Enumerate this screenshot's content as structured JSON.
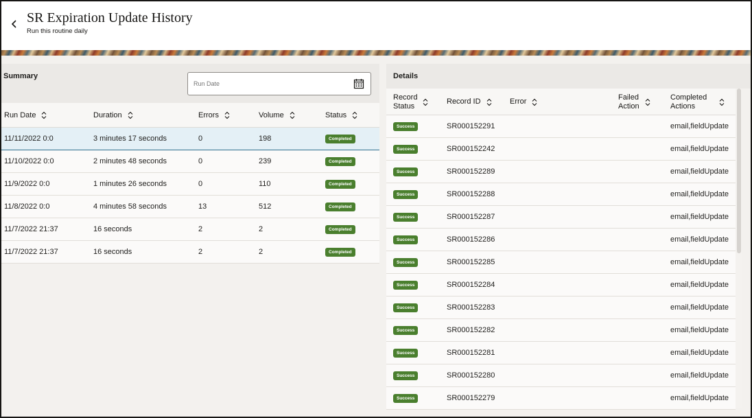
{
  "header": {
    "title": "SR Expiration Update History",
    "subtitle": "Run this routine daily"
  },
  "summary": {
    "label": "Summary",
    "run_date_placeholder": "Run Date",
    "columns": [
      "Run Date",
      "Duration",
      "Errors",
      "Volume",
      "Status"
    ],
    "rows": [
      {
        "run_date": "11/11/2022 0:0",
        "duration": "3 minutes 17 seconds",
        "errors": "0",
        "volume": "198",
        "status": "Completed"
      },
      {
        "run_date": "11/10/2022 0:0",
        "duration": "2 minutes 48 seconds",
        "errors": "0",
        "volume": "239",
        "status": "Completed"
      },
      {
        "run_date": "11/9/2022 0:0",
        "duration": "1 minutes 26 seconds",
        "errors": "0",
        "volume": "110",
        "status": "Completed"
      },
      {
        "run_date": "11/8/2022 0:0",
        "duration": "4 minutes 58 seconds",
        "errors": "13",
        "volume": "512",
        "status": "Completed"
      },
      {
        "run_date": "11/7/2022 21:37",
        "duration": "16 seconds",
        "errors": "2",
        "volume": "2",
        "status": "Completed"
      },
      {
        "run_date": "11/7/2022 21:37",
        "duration": "16 seconds",
        "errors": "2",
        "volume": "2",
        "status": "Completed"
      }
    ]
  },
  "details": {
    "label": "Details",
    "columns": {
      "record_status_1": "Record",
      "record_status_2": "Status",
      "record_id": "Record ID",
      "error": "Error",
      "failed_action_1": "Failed",
      "failed_action_2": "Action",
      "completed_actions_1": "Completed",
      "completed_actions_2": "Actions"
    },
    "rows": [
      {
        "status": "Success",
        "record_id": "SR000152291",
        "error": "",
        "failed_action": "",
        "completed_actions": "email,fieldUpdate"
      },
      {
        "status": "Success",
        "record_id": "SR000152242",
        "error": "",
        "failed_action": "",
        "completed_actions": "email,fieldUpdate"
      },
      {
        "status": "Success",
        "record_id": "SR000152289",
        "error": "",
        "failed_action": "",
        "completed_actions": "email,fieldUpdate"
      },
      {
        "status": "Success",
        "record_id": "SR000152288",
        "error": "",
        "failed_action": "",
        "completed_actions": "email,fieldUpdate"
      },
      {
        "status": "Success",
        "record_id": "SR000152287",
        "error": "",
        "failed_action": "",
        "completed_actions": "email,fieldUpdate"
      },
      {
        "status": "Success",
        "record_id": "SR000152286",
        "error": "",
        "failed_action": "",
        "completed_actions": "email,fieldUpdate"
      },
      {
        "status": "Success",
        "record_id": "SR000152285",
        "error": "",
        "failed_action": "",
        "completed_actions": "email,fieldUpdate"
      },
      {
        "status": "Success",
        "record_id": "SR000152284",
        "error": "",
        "failed_action": "",
        "completed_actions": "email,fieldUpdate"
      },
      {
        "status": "Success",
        "record_id": "SR000152283",
        "error": "",
        "failed_action": "",
        "completed_actions": "email,fieldUpdate"
      },
      {
        "status": "Success",
        "record_id": "SR000152282",
        "error": "",
        "failed_action": "",
        "completed_actions": "email,fieldUpdate"
      },
      {
        "status": "Success",
        "record_id": "SR000152281",
        "error": "",
        "failed_action": "",
        "completed_actions": "email,fieldUpdate"
      },
      {
        "status": "Success",
        "record_id": "SR000152280",
        "error": "",
        "failed_action": "",
        "completed_actions": "email,fieldUpdate"
      },
      {
        "status": "Success",
        "record_id": "SR000152279",
        "error": "",
        "failed_action": "",
        "completed_actions": "email,fieldUpdate"
      }
    ]
  },
  "colors": {
    "badge_green": "#4a7f2e",
    "selected_row": "#e4f0f6"
  },
  "icons": {
    "back": "chevron-left-icon",
    "calendar": "calendar-icon",
    "sort": "sort-icon"
  }
}
